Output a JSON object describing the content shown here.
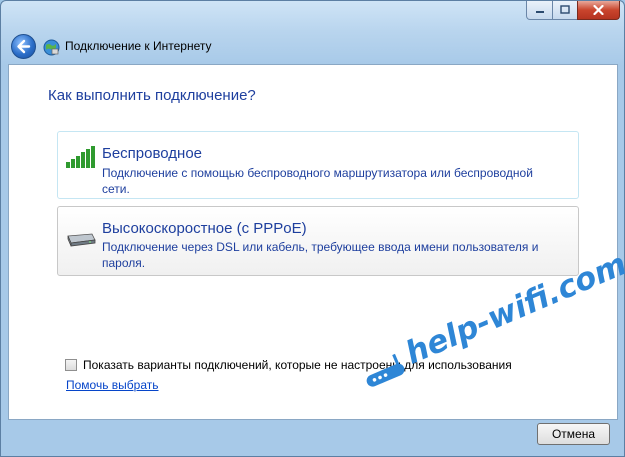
{
  "window": {
    "title": "Подключение к Интернету",
    "controls": {
      "minimize_icon": "minimize-icon",
      "maximize_icon": "maximize-icon",
      "close_icon": "close-icon"
    }
  },
  "main": {
    "question": "Как выполнить подключение?",
    "options": [
      {
        "title": "Беспроводное",
        "description": "Подключение с помощью беспроводного маршрутизатора или беспроводной сети.",
        "icon": "wireless-signal-icon"
      },
      {
        "title": "Высокоскоростное (с PPPoE)",
        "description": "Подключение через DSL или кабель, требующее ввода имени пользователя и пароля.",
        "icon": "modem-icon"
      }
    ],
    "checkbox_label": "Показать варианты подключений, которые не настроены для использования",
    "checkbox_checked": false,
    "help_link": "Помочь выбрать"
  },
  "footer": {
    "cancel_label": "Отмена"
  },
  "watermark": {
    "text": "help-wifi.com"
  },
  "colors": {
    "accent_text": "#1e3f9e",
    "link": "#0645c9",
    "watermark": "#2e86d6"
  }
}
